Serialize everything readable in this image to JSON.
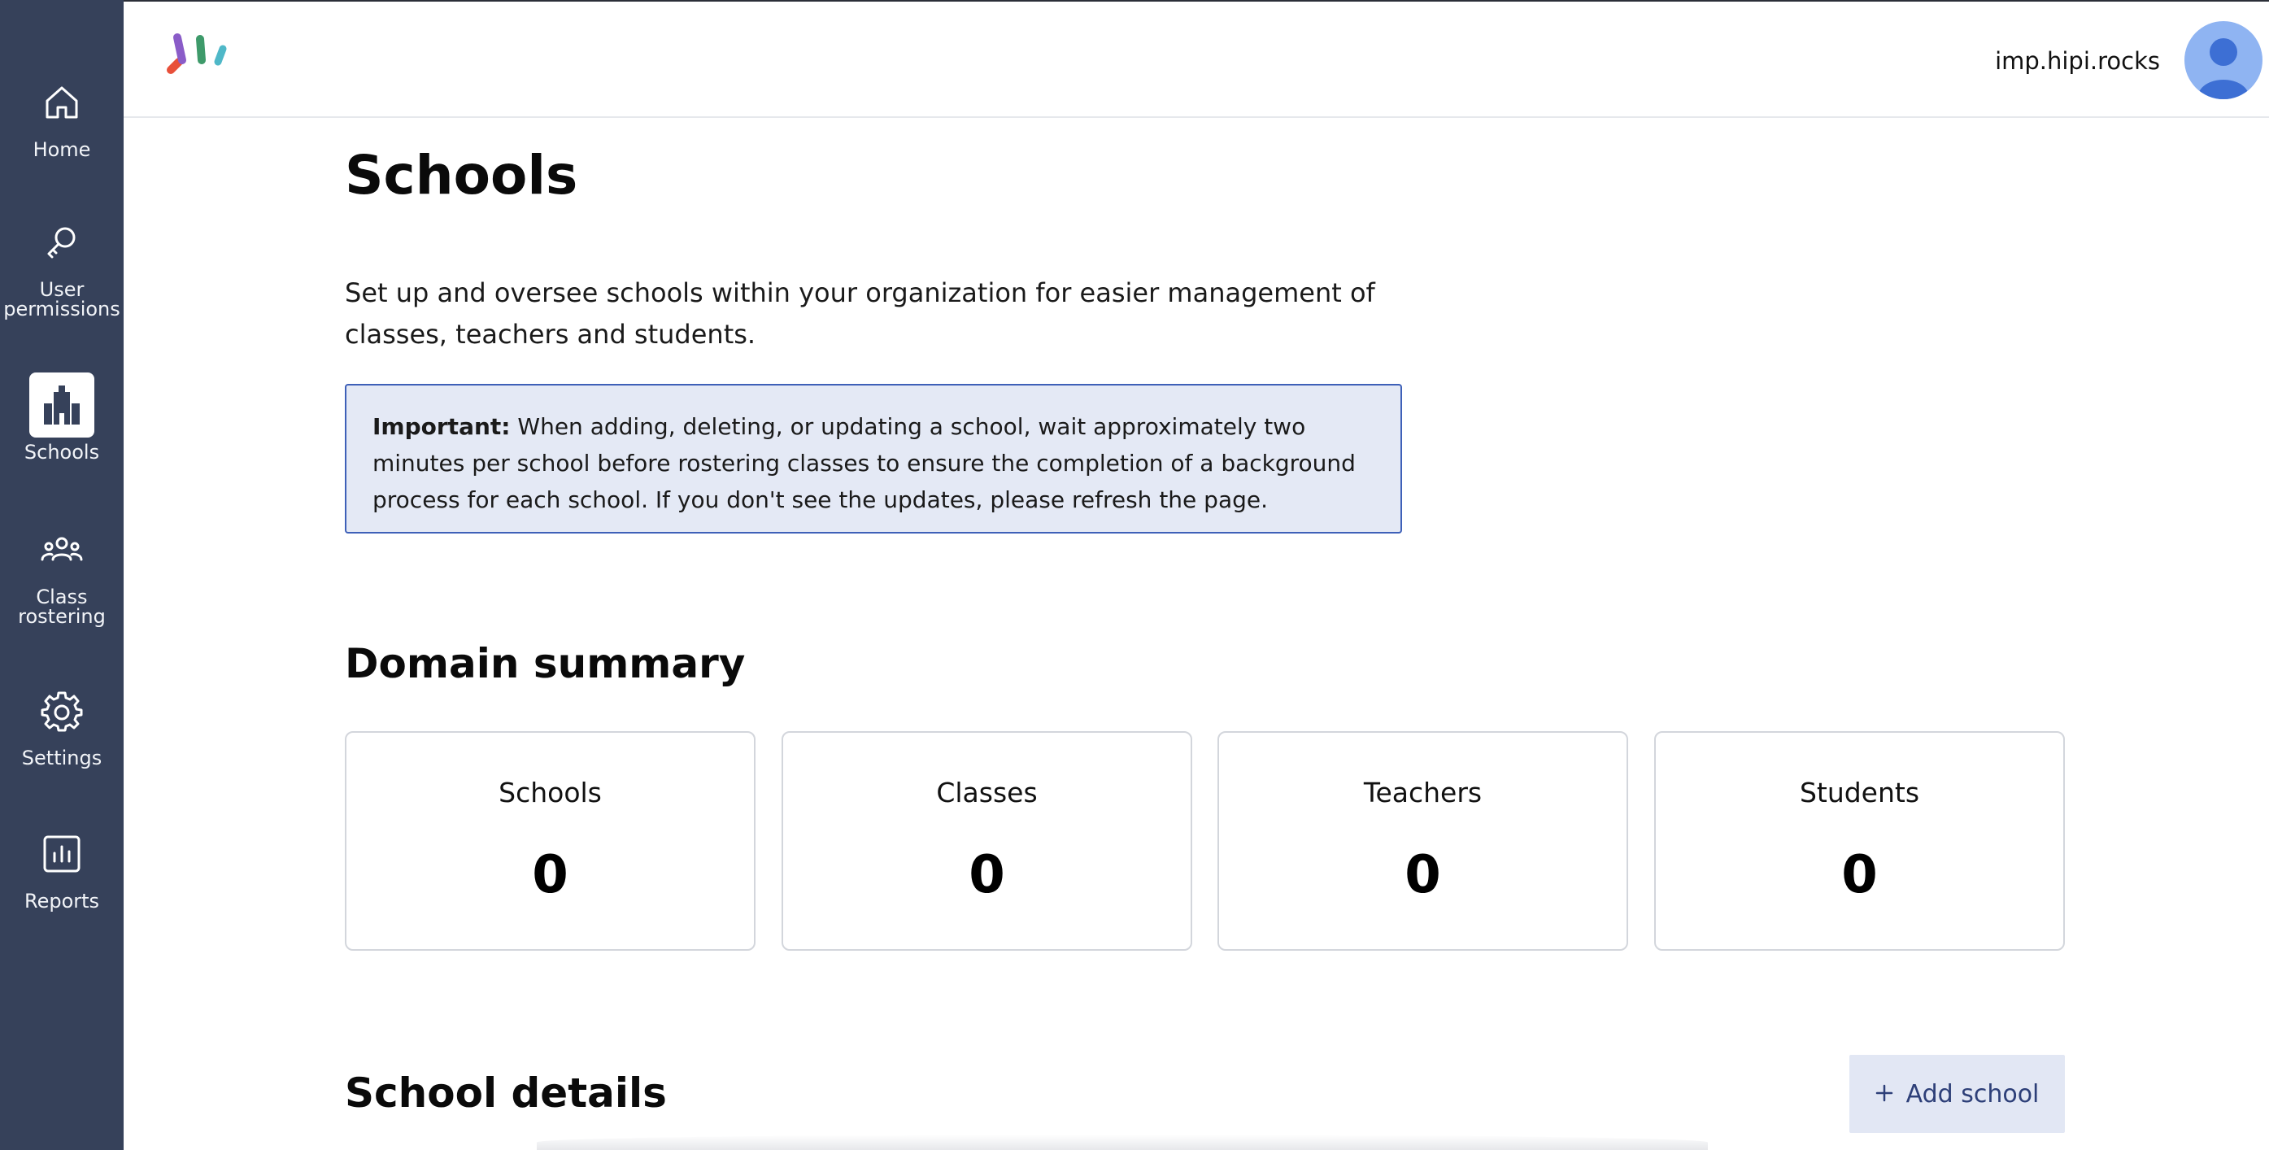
{
  "sidebar": {
    "items": [
      {
        "label": "Home",
        "icon": "home-icon",
        "active": false
      },
      {
        "label": "User permissions",
        "label_lines": [
          "User",
          "permissions"
        ],
        "icon": "key-icon",
        "active": false
      },
      {
        "label": "Schools",
        "icon": "school-icon",
        "active": true
      },
      {
        "label": "Class rostering",
        "label_lines": [
          "Class",
          "rostering"
        ],
        "icon": "people-group-icon",
        "active": false
      },
      {
        "label": "Settings",
        "icon": "gear-icon",
        "active": false
      },
      {
        "label": "Reports",
        "icon": "bar-chart-icon",
        "active": false
      }
    ]
  },
  "header": {
    "username": "imp.hipi.rocks",
    "avatar_icon": "user-avatar-icon"
  },
  "page": {
    "title": "Schools",
    "intro": "Set up and oversee schools within your organization for easier management of classes, teachers and students.",
    "notice_strong": "Important:",
    "notice_text": " When adding, deleting, or updating a school, wait approximately two minutes per school before rostering classes to ensure the completion of a background process for each school. If you don't see the updates, please refresh the page."
  },
  "summary": {
    "title": "Domain summary",
    "cards": [
      {
        "label": "Schools",
        "value": "0"
      },
      {
        "label": "Classes",
        "value": "0"
      },
      {
        "label": "Teachers",
        "value": "0"
      },
      {
        "label": "Students",
        "value": "0"
      }
    ]
  },
  "details": {
    "title": "School details",
    "add_button_label": "Add school",
    "add_button_icon": "plus-icon"
  },
  "colors": {
    "sidebar_bg": "#36415a",
    "notice_bg": "#e4e9f5",
    "notice_border": "#3e60b8",
    "button_bg": "#e2e7f4",
    "button_text": "#2d3f78",
    "avatar_bg": "#8fb4f2",
    "avatar_figure": "#3d6fd4"
  }
}
